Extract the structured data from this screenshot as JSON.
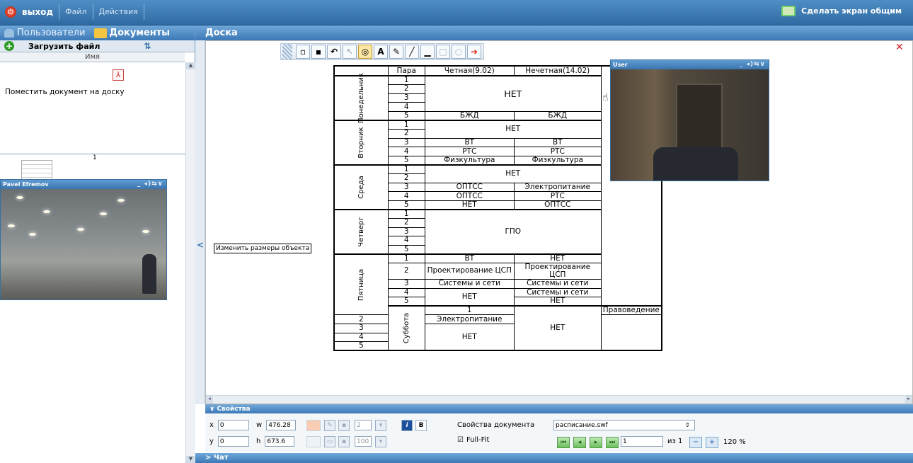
{
  "topbar": {
    "exit_label": "выход",
    "file_label": "Файл",
    "actions_label": "Действия",
    "share_label": "Сделать экран общим"
  },
  "left_panel": {
    "tab_users": "Пользователи",
    "tab_documents": "Документы",
    "upload_label": "Загрузить файл",
    "name_column": "Имя",
    "place_doc_label": "Поместить документ на доску",
    "thumb_page": "1"
  },
  "videos": {
    "pavel_name": "Pavel Efremov",
    "user_name": "User",
    "controls": "_ ◂)⇆∨"
  },
  "board": {
    "title": "Доска",
    "resize_tooltip": "Изменить размеры объекта"
  },
  "schedule": {
    "header": [
      "Пара",
      "Четная(9.02)",
      "Нечетная(14.02)"
    ],
    "days": [
      "Понедельник",
      "Вторник",
      "Среда",
      "Четверг",
      "Пятница",
      "Суббота"
    ],
    "nums": [
      "1",
      "2",
      "3",
      "4",
      "5"
    ],
    "mon": {
      "big": "НЕТ",
      "p5_even": "БЖД",
      "p5_odd": "БЖД"
    },
    "tue": {
      "p12": "НЕТ",
      "p3_even": "ВТ",
      "p3_odd": "ВТ",
      "p4_even": "РТС",
      "p4_odd": "РТС",
      "p5_even": "Физкультура",
      "p5_odd": "Физкультура"
    },
    "wed": {
      "p12": "НЕТ",
      "p3_even": "ОПТСС",
      "p3_odd": "Электропитание",
      "p4_even": "ОПТСС",
      "p4_odd": "РТС",
      "p5_even": "НЕТ",
      "p5_odd": "ОПТСС"
    },
    "thu": {
      "big": "ГПО"
    },
    "fri": {
      "p1_even": "ВТ",
      "p1_odd": "НЕТ",
      "p2_even": "Проектирование ЦСП",
      "p2_odd": "Проектирование ЦСП",
      "p3_even": "Системы и сети",
      "p3_odd": "Системы и сети",
      "p45_even": "НЕТ",
      "p4_odd": "Системы и сети",
      "p5_odd": "НЕТ"
    },
    "sat": {
      "even": "НЕТ",
      "p1_odd": "Правоведение",
      "p2_odd": "Электропитание",
      "p345_odd": "НЕТ"
    }
  },
  "properties": {
    "title": "Свойства",
    "x_label": "x",
    "y_label": "y",
    "w_label": "w",
    "h_label": "h",
    "x_value": "0",
    "y_value": "0",
    "w_value": "476.28",
    "h_value": "673.6",
    "line_width": "2",
    "opacity": "100",
    "italic_label": "i",
    "bold_label": "B",
    "doc_props_label": "Свойства документа",
    "doc_name": "расписание.swf",
    "fullfit_label": "Full-Fit",
    "page_value": "1",
    "page_of": "из 1",
    "zoom_level": "120 %"
  },
  "chat": {
    "label": "Чат"
  }
}
